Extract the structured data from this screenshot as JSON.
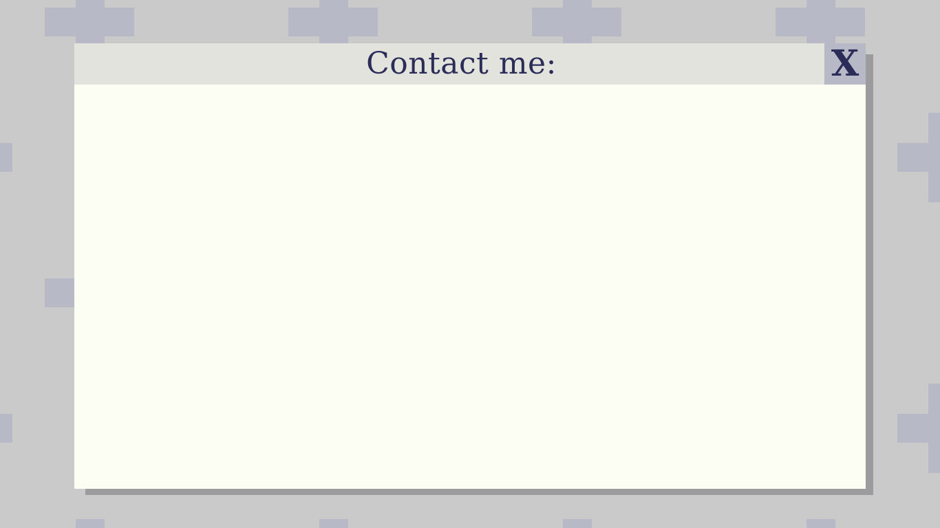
{
  "colors": {
    "background": "#cacaca",
    "pattern": "#b8b9c7",
    "dialog_body": "#fcfdf3",
    "titlebar": "#e2e3dd",
    "text": "#2b2d58",
    "shadow": "#9c9c9e"
  },
  "dialog": {
    "title": "Contact me:",
    "close_label": "X",
    "close_icon": "close-icon"
  }
}
